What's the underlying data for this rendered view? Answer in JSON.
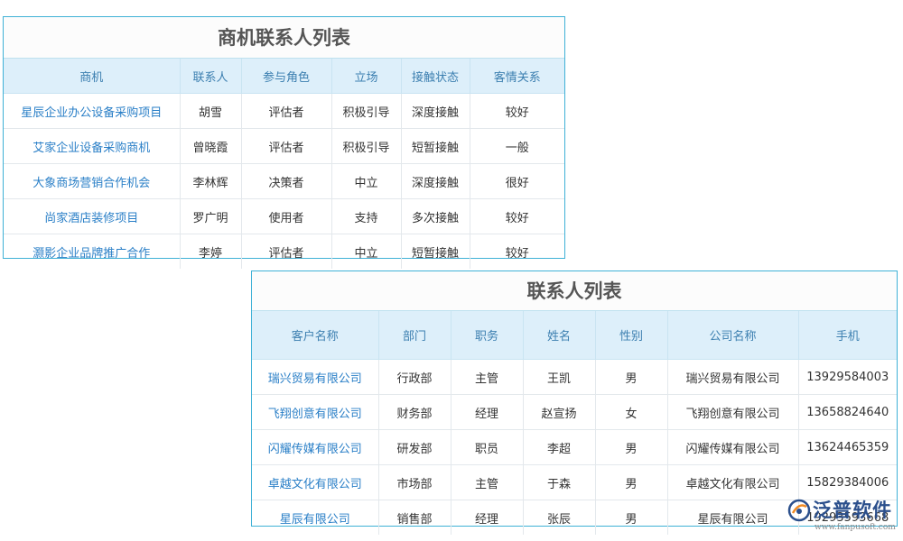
{
  "opportunity_contacts": {
    "title": "商机联系人列表",
    "headers": [
      "商机",
      "联系人",
      "参与角色",
      "立场",
      "接触状态",
      "客情关系"
    ],
    "rows": [
      [
        "星辰企业办公设备采购项目",
        "胡雪",
        "评估者",
        "积极引导",
        "深度接触",
        "较好"
      ],
      [
        "艾家企业设备采购商机",
        "曾晓霞",
        "评估者",
        "积极引导",
        "短暂接触",
        "一般"
      ],
      [
        "大象商场营销合作机会",
        "李林辉",
        "决策者",
        "中立",
        "深度接触",
        "很好"
      ],
      [
        "尚家酒店装修项目",
        "罗广明",
        "使用者",
        "支持",
        "多次接触",
        "较好"
      ],
      [
        "灏影企业品牌推广合作",
        "李婷",
        "评估者",
        "中立",
        "短暂接触",
        "较好"
      ]
    ]
  },
  "contacts": {
    "title": "联系人列表",
    "headers": [
      "客户名称",
      "部门",
      "职务",
      "姓名",
      "性别",
      "公司名称",
      "手机"
    ],
    "rows": [
      [
        "瑞兴贸易有限公司",
        "行政部",
        "主管",
        "王凯",
        "男",
        "瑞兴贸易有限公司",
        "13929584003"
      ],
      [
        "飞翔创意有限公司",
        "财务部",
        "经理",
        "赵宣扬",
        "女",
        "飞翔创意有限公司",
        "13658824640"
      ],
      [
        "闪耀传媒有限公司",
        "研发部",
        "职员",
        "李超",
        "男",
        "闪耀传媒有限公司",
        "13624465359"
      ],
      [
        "卓越文化有限公司",
        "市场部",
        "主管",
        "于森",
        "男",
        "卓越文化有限公司",
        "15829384006"
      ],
      [
        "星辰有限公司",
        "销售部",
        "经理",
        "张辰",
        "男",
        "星辰有限公司",
        "19293593668"
      ]
    ]
  },
  "watermark": {
    "brand": "泛普软件",
    "url": "www.fanpusoft.com",
    "icon": "fanpu-logo-icon"
  }
}
